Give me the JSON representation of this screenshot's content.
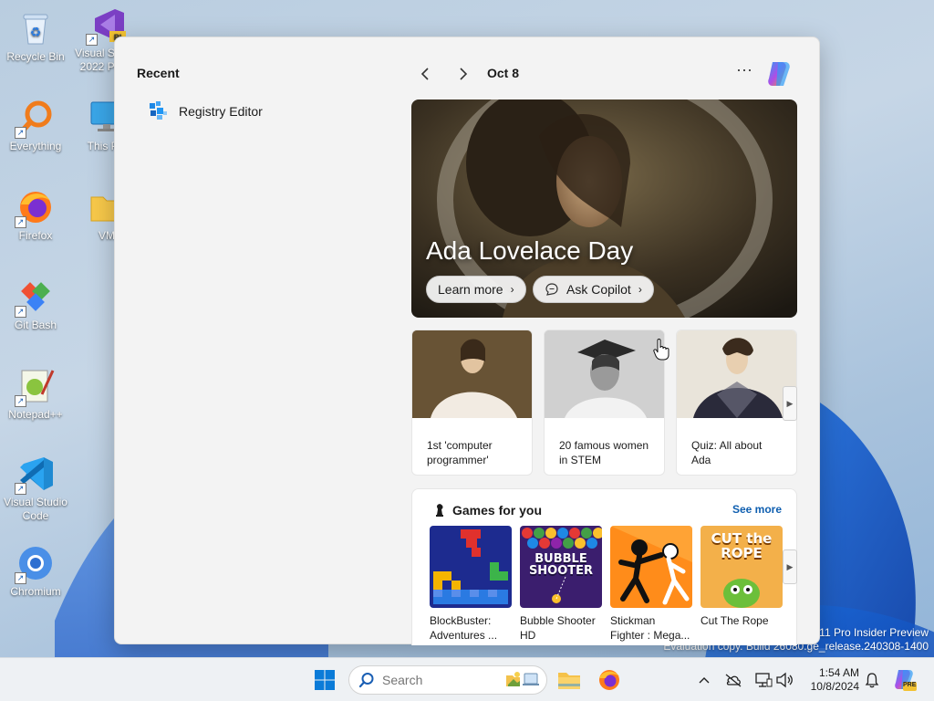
{
  "desktop": {
    "icons": [
      {
        "label": "Recycle Bin"
      },
      {
        "label": "Visual Studio 2022 Pre..."
      },
      {
        "label": "Everything"
      },
      {
        "label": "This PC"
      },
      {
        "label": "Firefox"
      },
      {
        "label": "VM"
      },
      {
        "label": "Git Bash"
      },
      {
        "label": "Notepad++"
      },
      {
        "label": "Visual Studio Code"
      },
      {
        "label": "Chromium"
      }
    ],
    "watermark_line1": "11 Pro Insider Preview",
    "watermark_line2": "Evaluation copy. Build 26080.ge_release.240308-1400"
  },
  "start_panel": {
    "recent_title": "Recent",
    "recent_items": [
      {
        "label": "Registry Editor",
        "icon": "registry-editor-icon"
      }
    ],
    "date_label": "Oct 8",
    "more_label": "···",
    "hero": {
      "title": "Ada Lovelace Day",
      "learn_more": "Learn more",
      "ask_copilot": "Ask Copilot"
    },
    "cards": [
      {
        "text": "1st 'computer programmer'"
      },
      {
        "text": "20 famous women in STEM"
      },
      {
        "text": "Quiz: All about Ada"
      }
    ],
    "games": {
      "title": "Games for you",
      "see_more": "See more",
      "items": [
        {
          "name": "BlockBuster: Adventures ..."
        },
        {
          "name": "Bubble Shooter HD",
          "tile_text": "BUBBLE SHOOTER"
        },
        {
          "name": "Stickman Fighter : Mega..."
        },
        {
          "name": "Cut The Rope",
          "tile_text": "CUT the ROPE"
        }
      ]
    }
  },
  "taskbar": {
    "search_placeholder": "Search",
    "time": "1:54 AM",
    "date": "10/8/2024",
    "copilot_badge": "PRE"
  },
  "colors": {
    "accent": "#0f5fb0",
    "panel_bg": "#f3f3f3",
    "taskbar_bg": "#eef1f4"
  }
}
